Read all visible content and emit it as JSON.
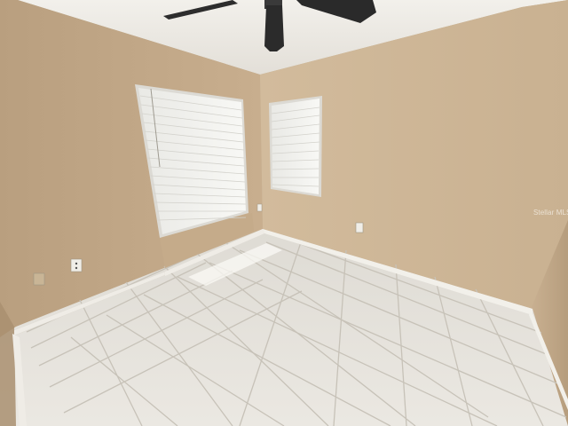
{
  "scene": {
    "subject": "empty-bedroom",
    "colors": {
      "wall": "#cdb596",
      "wall_shadow": "#bca484",
      "ceiling": "#ece9e3",
      "floor_tile": "#e7e4de",
      "grout": "#bdb8ae",
      "baseboard": "#f1efe9",
      "window_blind": "#f4f4f1",
      "fan_blade": "#2b2b2b"
    },
    "elements": {
      "ceiling_fan": "ceiling-fan-icon",
      "left_window": "window-blinds-left",
      "center_window": "window-blinds-center",
      "outlets": "electrical-outlet-icon"
    }
  },
  "watermark": {
    "text": "Stellar MLS"
  }
}
